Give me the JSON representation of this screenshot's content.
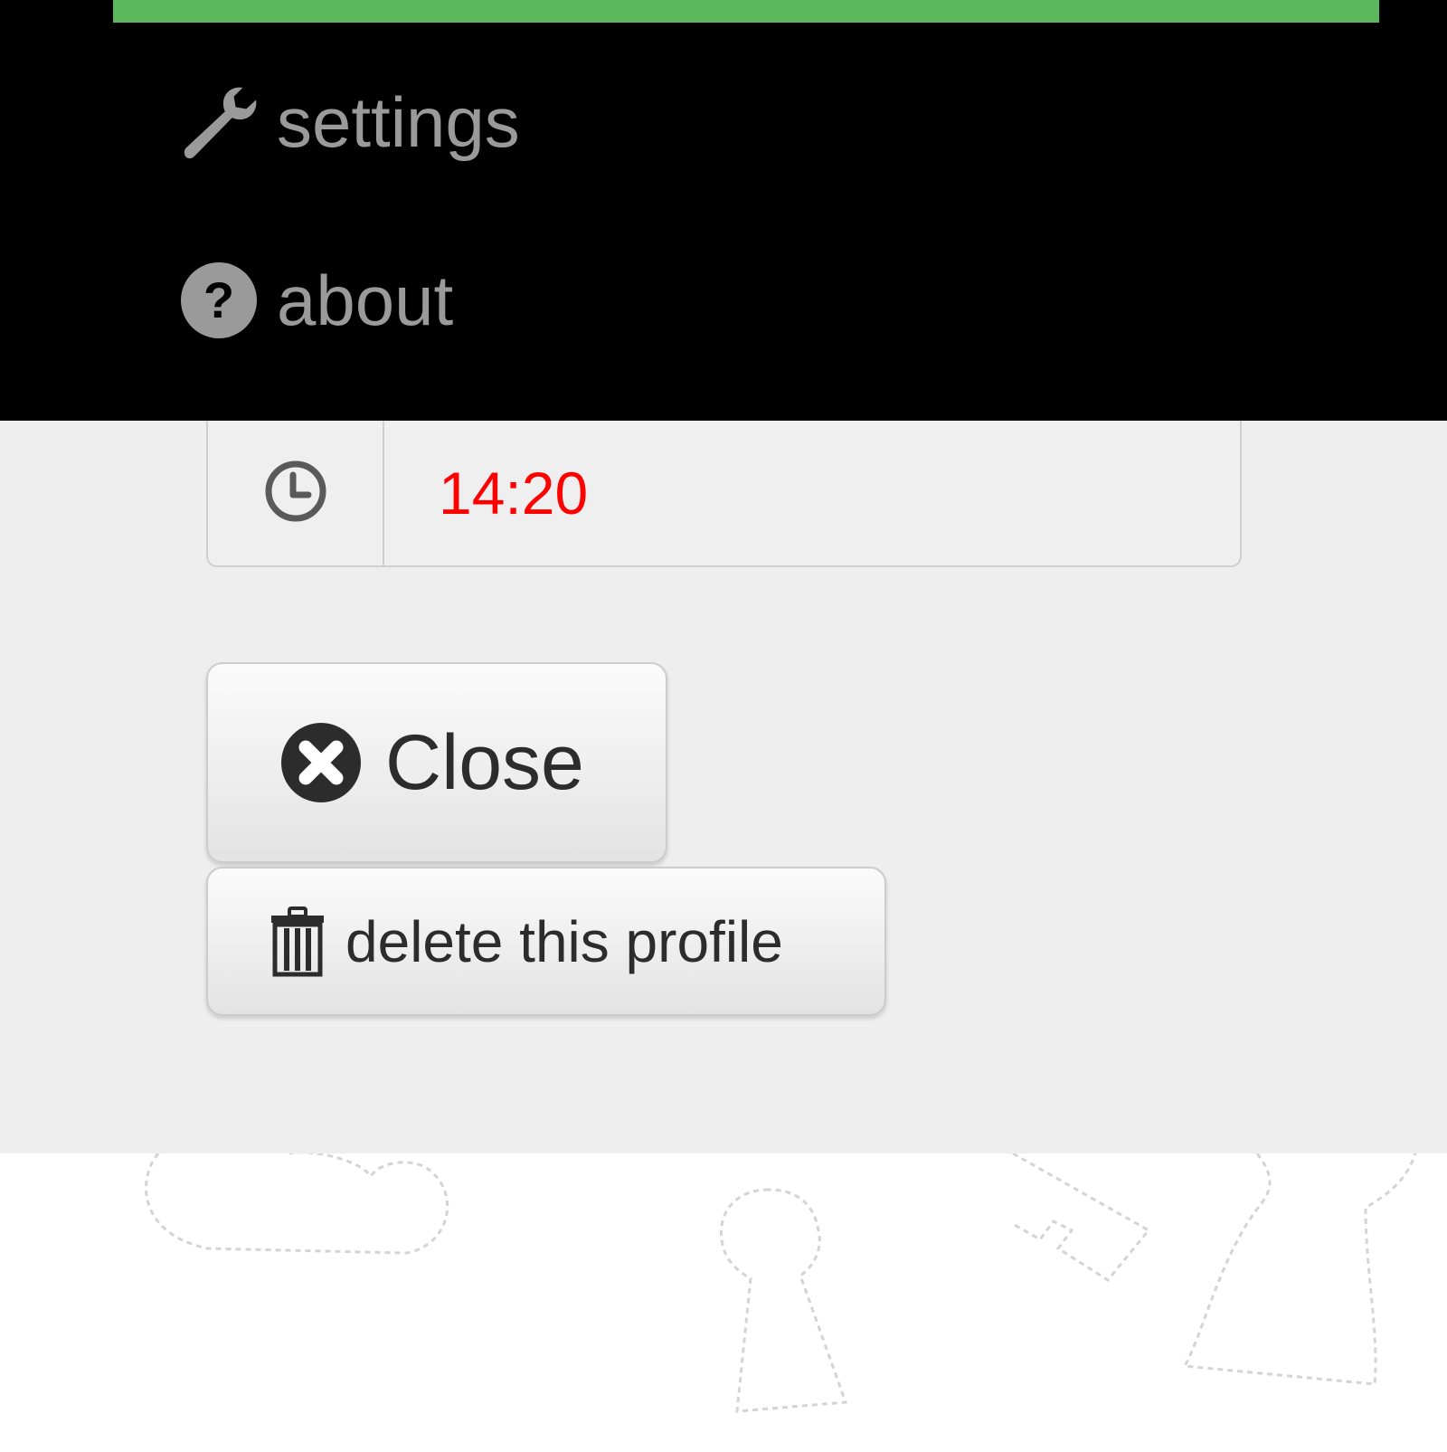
{
  "menu": {
    "items": [
      {
        "label": "settings",
        "icon": "wrench-icon"
      },
      {
        "label": "about",
        "icon": "question-circle-icon"
      }
    ]
  },
  "time": {
    "value": "14:20",
    "icon": "clock-icon",
    "value_color": "#ff0000"
  },
  "actions": {
    "close_label": "Close",
    "delete_label": "delete this profile"
  },
  "colors": {
    "accent": "#5cb85c",
    "menu_bg": "#000000",
    "panel_bg": "#eeeeee",
    "menu_text": "#9a9a9a"
  }
}
